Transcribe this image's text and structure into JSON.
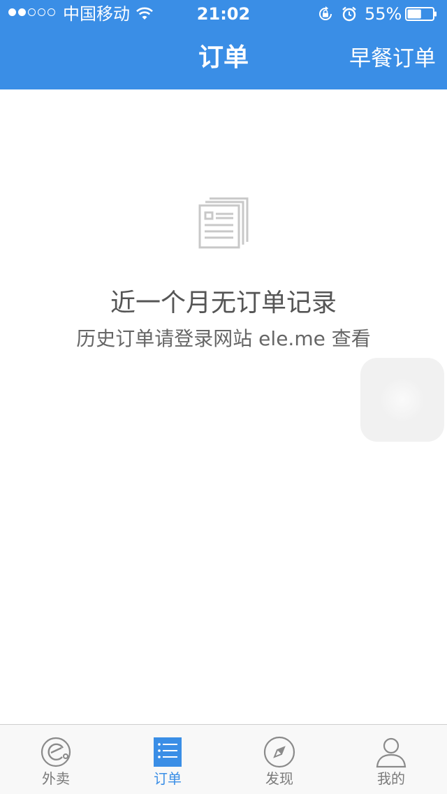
{
  "status_bar": {
    "carrier": "中国移动",
    "time": "21:02",
    "battery_percent": "55%",
    "battery_level": 0.55
  },
  "nav": {
    "title": "订单",
    "right_action": "早餐订单"
  },
  "empty_state": {
    "icon": "document-icon",
    "title": "近一个月无订单记录",
    "subtitle": "历史订单请登录网站 ele.me 查看"
  },
  "tabs": [
    {
      "label": "外卖",
      "icon": "eleme-logo-icon",
      "active": false
    },
    {
      "label": "订单",
      "icon": "list-icon",
      "active": true
    },
    {
      "label": "发现",
      "icon": "compass-icon",
      "active": false
    },
    {
      "label": "我的",
      "icon": "person-icon",
      "active": false
    }
  ],
  "colors": {
    "primary": "#3a8ee6",
    "tab_inactive": "#7a7a7a",
    "empty_icon": "#c8c8c8"
  }
}
